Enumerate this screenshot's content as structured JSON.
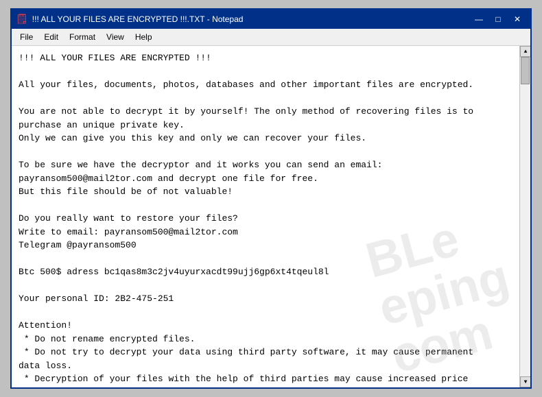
{
  "window": {
    "title": "!!! ALL YOUR FILES ARE ENCRYPTED !!!.TXT - Notepad",
    "icon": "📄"
  },
  "titlebar": {
    "minimize_label": "—",
    "maximize_label": "□",
    "close_label": "✕"
  },
  "menu": {
    "items": [
      "File",
      "Edit",
      "Format",
      "View",
      "Help"
    ]
  },
  "content": {
    "text": "!!! ALL YOUR FILES ARE ENCRYPTED !!!\n\nAll your files, documents, photos, databases and other important files are encrypted.\n\nYou are not able to decrypt it by yourself! The only method of recovering files is to\npurchase an unique private key.\nOnly we can give you this key and only we can recover your files.\n\nTo be sure we have the decryptor and it works you can send an email:\npayransom500@mail2tor.com and decrypt one file for free.\nBut this file should be of not valuable!\n\nDo you really want to restore your files?\nWrite to email: payransom500@mail2tor.com\nTelegram @payransom500\n\nBtc 500$ adress bc1qas8m3c2jv4uyurxacdt99ujj6gp6xt4tqeul8l\n\nYour personal ID: 2B2-475-251\n\nAttention!\n * Do not rename encrypted files.\n * Do not try to decrypt your data using third party software, it may cause permanent\ndata loss.\n * Decryption of your files with the help of third parties may cause increased price\n(they add their fee to our) or you can become a victim of a scam."
  },
  "watermark": {
    "line1": "BLe",
    "line2": "eping",
    "text": "BLeeping\nComputer"
  }
}
